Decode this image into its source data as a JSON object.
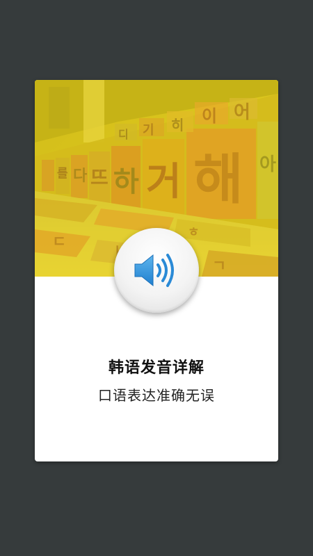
{
  "card": {
    "title": "韩语发音详解",
    "subtitle": "口语表达准确无误"
  },
  "banner": {
    "wall_letters": [
      "해",
      "거",
      "하",
      "뜨",
      "다",
      "를",
      "어",
      "이",
      "히",
      "기",
      "디",
      "아"
    ],
    "floor_letters": [
      "ㄷ",
      "ㅏ",
      "ㄱ",
      "ㅎ"
    ],
    "icon": "korean-letter-wall-photo"
  },
  "audio_button": {
    "icon": "speaker-volume-icon"
  },
  "colors": {
    "background": "#363b3c",
    "card": "#ffffff",
    "banner_tint": "#d8c21a",
    "speaker_blue": "#2a8ad6"
  }
}
